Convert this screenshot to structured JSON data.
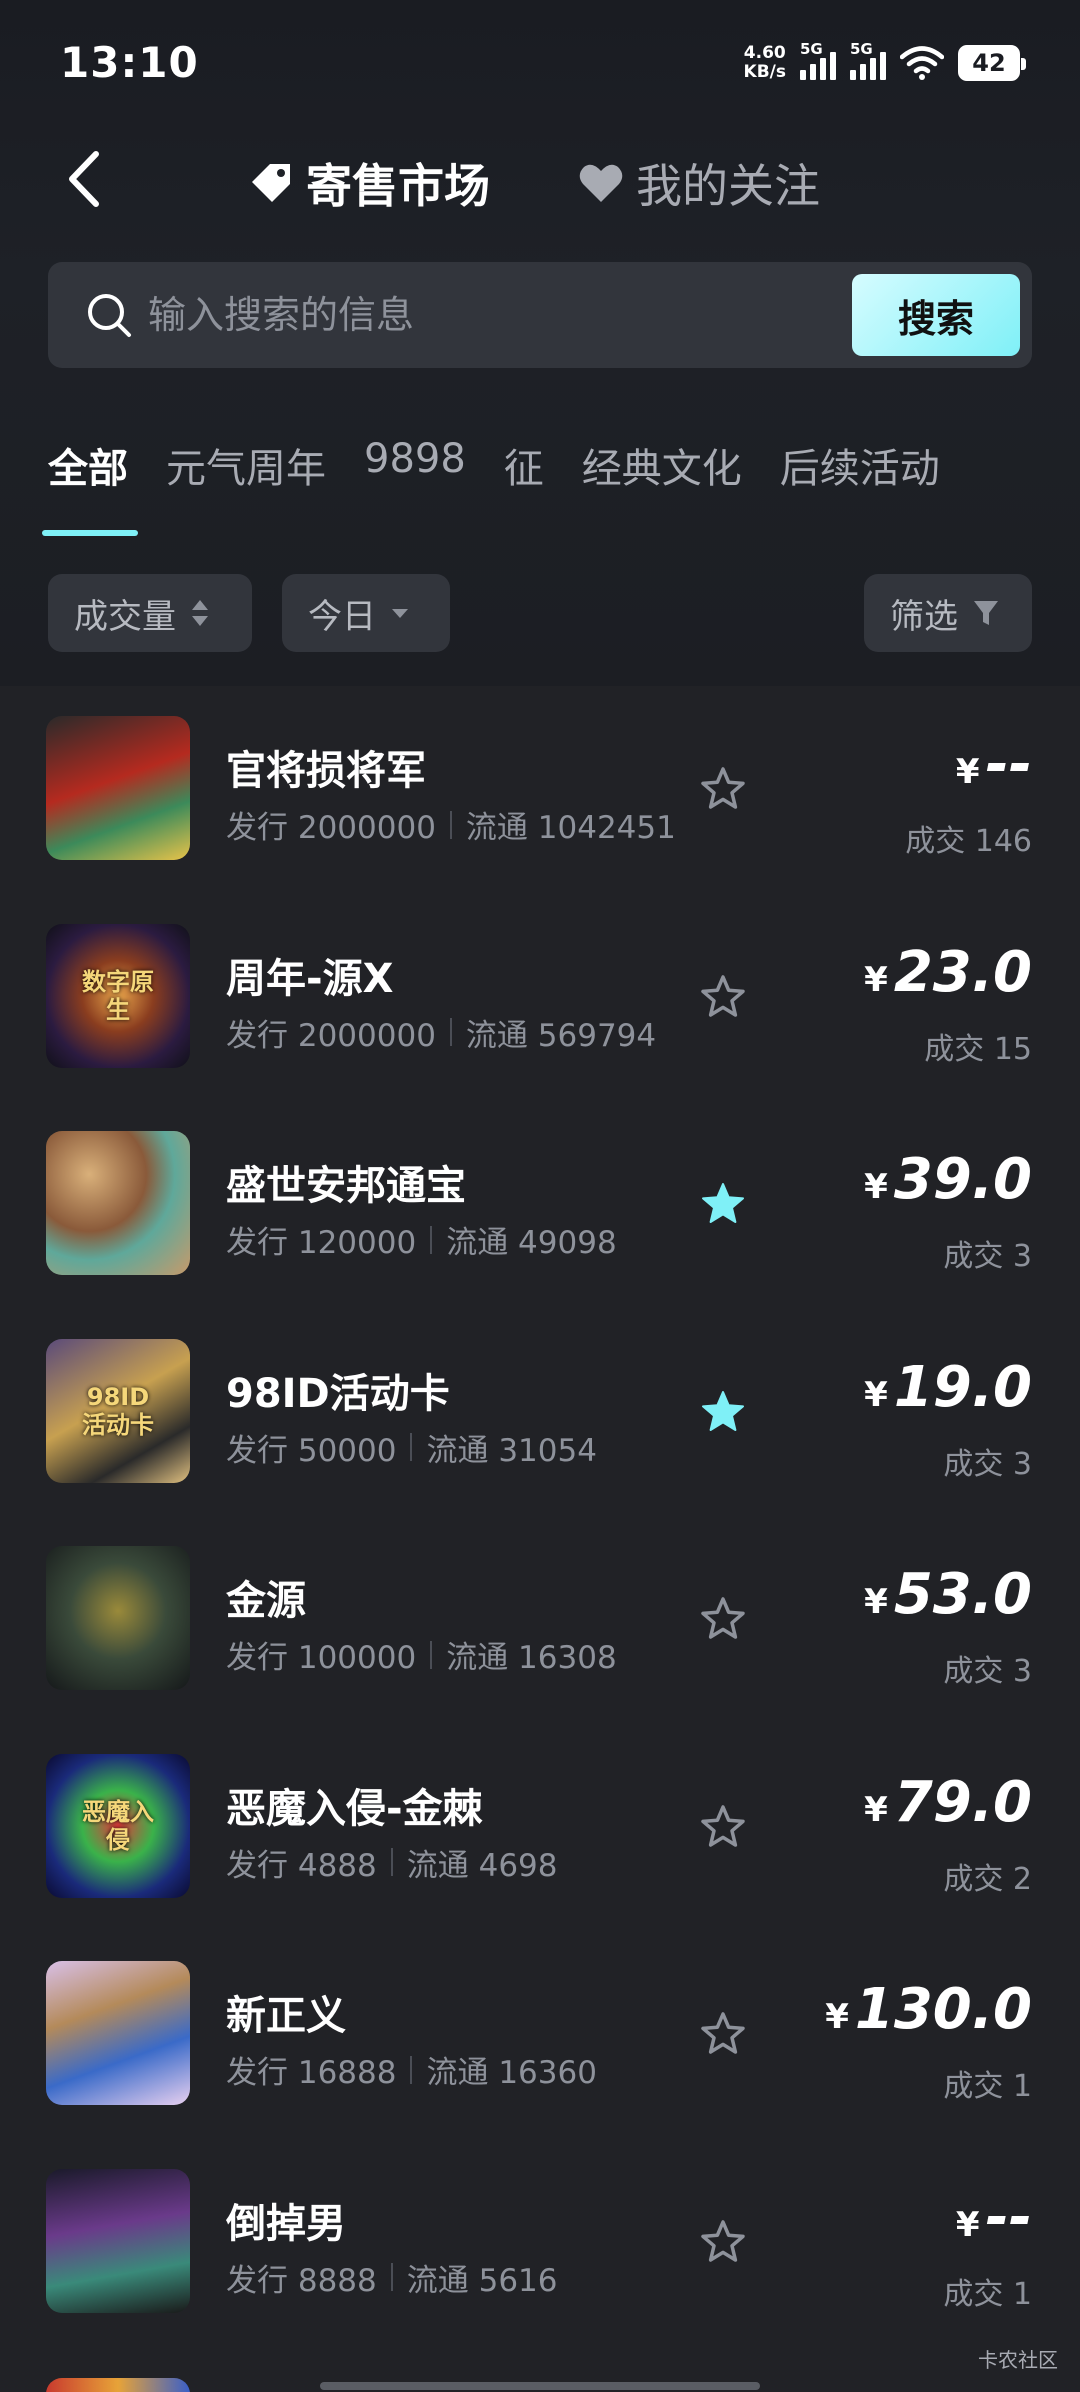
{
  "status_bar": {
    "time": "13:10",
    "net_speed_value": "4.60",
    "net_speed_unit": "KB/s",
    "signal_1": "5G",
    "signal_2": "5G",
    "battery": "42"
  },
  "header": {
    "market_tab": "寄售市场",
    "follow_tab": "我的关注"
  },
  "search": {
    "placeholder": "输入搜索的信息",
    "button": "搜索"
  },
  "categories": [
    "全部",
    "元气周年",
    "9898",
    "征",
    "经典文化",
    "后续活动"
  ],
  "filters": {
    "volume": "成交量",
    "period": "今日",
    "filter": "筛选"
  },
  "labels": {
    "issue": "发行",
    "circulation": "流通",
    "trades": "成交",
    "currency": "¥"
  },
  "items": [
    {
      "name": "官将损将军",
      "issue": "2000000",
      "circulation": "1042451",
      "price": "--",
      "trades": "146",
      "favorited": false
    },
    {
      "name": "周年-源X",
      "issue": "2000000",
      "circulation": "569794",
      "price": "23.0",
      "trades": "15",
      "favorited": false
    },
    {
      "name": "盛世安邦通宝",
      "issue": "120000",
      "circulation": "49098",
      "price": "39.0",
      "trades": "3",
      "favorited": true
    },
    {
      "name": "98ID活动卡",
      "issue": "50000",
      "circulation": "31054",
      "price": "19.0",
      "trades": "3",
      "favorited": true
    },
    {
      "name": "金源",
      "issue": "100000",
      "circulation": "16308",
      "price": "53.0",
      "trades": "3",
      "favorited": false
    },
    {
      "name": "恶魔入侵-金棘",
      "issue": "4888",
      "circulation": "4698",
      "price": "79.0",
      "trades": "2",
      "favorited": false
    },
    {
      "name": "新正义",
      "issue": "16888",
      "circulation": "16360",
      "price": "130.0",
      "trades": "1",
      "favorited": false
    },
    {
      "name": "倒掉男",
      "issue": "8888",
      "circulation": "5616",
      "price": "--",
      "trades": "1",
      "favorited": false
    }
  ],
  "thumb_texts": {
    "item_2": "数字原生",
    "item_4": "98ID活动卡",
    "item_6": "恶魔入侵"
  },
  "watermark": "卡农社区",
  "colors": {
    "accent": "#7ff0f7",
    "background": "#212226",
    "muted_text": "#8e929b"
  }
}
